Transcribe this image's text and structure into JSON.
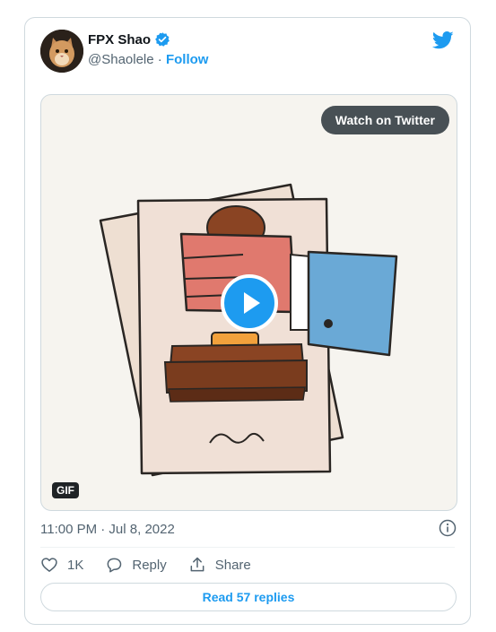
{
  "tweet": {
    "author_name": "FPX Shao",
    "handle": "@Shaolele",
    "separator": "·",
    "follow_label": "Follow",
    "timestamp": "11:00 PM · Jul 8, 2022"
  },
  "media": {
    "watch_label": "Watch on Twitter",
    "badge": "GIF"
  },
  "actions": {
    "like_count": "1K",
    "reply_label": "Reply",
    "share_label": "Share"
  },
  "footer": {
    "read_replies_label": "Read 57 replies"
  },
  "colors": {
    "accent": "#1d9bf0",
    "text_primary": "#0f1419",
    "text_secondary": "#536471",
    "border": "#cfd9de"
  },
  "icons": [
    "verified-badge-icon",
    "twitter-bird-icon",
    "play-icon",
    "info-icon",
    "heart-icon",
    "reply-icon",
    "share-icon"
  ]
}
